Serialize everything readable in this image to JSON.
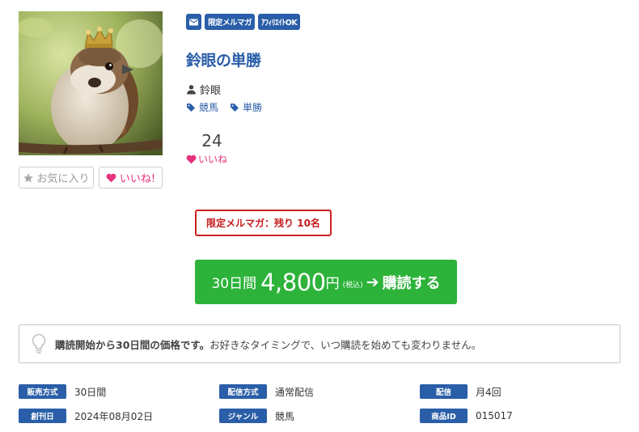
{
  "product": {
    "title": "鈴眼の単勝",
    "author": "鈴眼",
    "badges": [
      "限定メルマガ",
      "ｱﾌｨﾘｴｲﾄOK"
    ],
    "tags": [
      "競馬",
      "単勝"
    ],
    "like_count": "24",
    "like_label": "いいね",
    "thumbnail_icon": "sparrow-with-crown-image"
  },
  "actions": {
    "favorite_label": "お気に入り",
    "like_button_label": "いいね!"
  },
  "limit_notice": "限定メルマガ：残り 10名",
  "purchase": {
    "period": "30日間",
    "price": "4,800",
    "currency": "円",
    "tax": "(税込)",
    "cta": "購読する"
  },
  "info": {
    "bold": "購読開始から30日間の価格です。",
    "text": "お好きなタイミングで、いつ購読を始めても変わりません。"
  },
  "meta": [
    {
      "label": "販売方式",
      "value": "30日間"
    },
    {
      "label": "配信方式",
      "value": "通常配信"
    },
    {
      "label": "配信",
      "value": "月4回"
    },
    {
      "label": "創刊日",
      "value": "2024年08月02日"
    },
    {
      "label": "ジャンル",
      "value": "競馬"
    },
    {
      "label": "商品ID",
      "value": "015017"
    }
  ],
  "colors": {
    "accent_blue": "#2a5ea8",
    "buy_green": "#2db33a",
    "like_pink": "#e6317d",
    "limit_red": "#d01f1f"
  }
}
